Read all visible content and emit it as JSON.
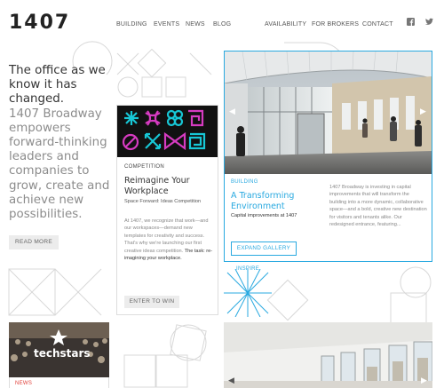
{
  "header": {
    "logo": "1407",
    "nav_left": [
      "BUILDING",
      "EVENTS",
      "NEWS",
      "BLOG"
    ],
    "nav_right": [
      "AVAILABILITY",
      "FOR BROKERS",
      "CONTACT"
    ],
    "social_icons": [
      "facebook-icon",
      "twitter-icon"
    ]
  },
  "hero": {
    "dark_text": "The office as we know it has changed.",
    "light_text": "1407 Broadway empowers forward-thinking leaders and companies to grow, create and achieve new possibilities.",
    "read_more": "READ MORE"
  },
  "competition_card": {
    "tag": "COMPETITION",
    "title": "Reimagine Your Workplace",
    "subtitle": "Space Forward: Ideas Competition",
    "body": "At 1407, we recognize that work—and our workspaces—demand new templates for creativity and success. That's why we're launching our first creative ideas competition.",
    "body_task_label": "The task:",
    "body_task": "re-imagining your workplace.",
    "button": "ENTER TO WIN"
  },
  "building_card": {
    "tag": "BUILDING",
    "title": "A Transforming Environment",
    "subtitle": "Capital improvements at 1407",
    "body": "1407 Broadway is investing in capital improvements that will transform the building into a more dynamic, collaborative space—and a bold, creative new destination for visitors and tenants alike. Our redesigned entrance, featuring...",
    "button": "EXPAND GALLERY"
  },
  "inspire_tag": "INSPIRE",
  "news_card": {
    "tag": "NEWS",
    "image_caption": "techstars"
  },
  "colors": {
    "accent_blue": "#29a9e0",
    "news_red": "#e0403a",
    "neon_cyan": "#17c7d6",
    "neon_magenta": "#d63bc1"
  }
}
